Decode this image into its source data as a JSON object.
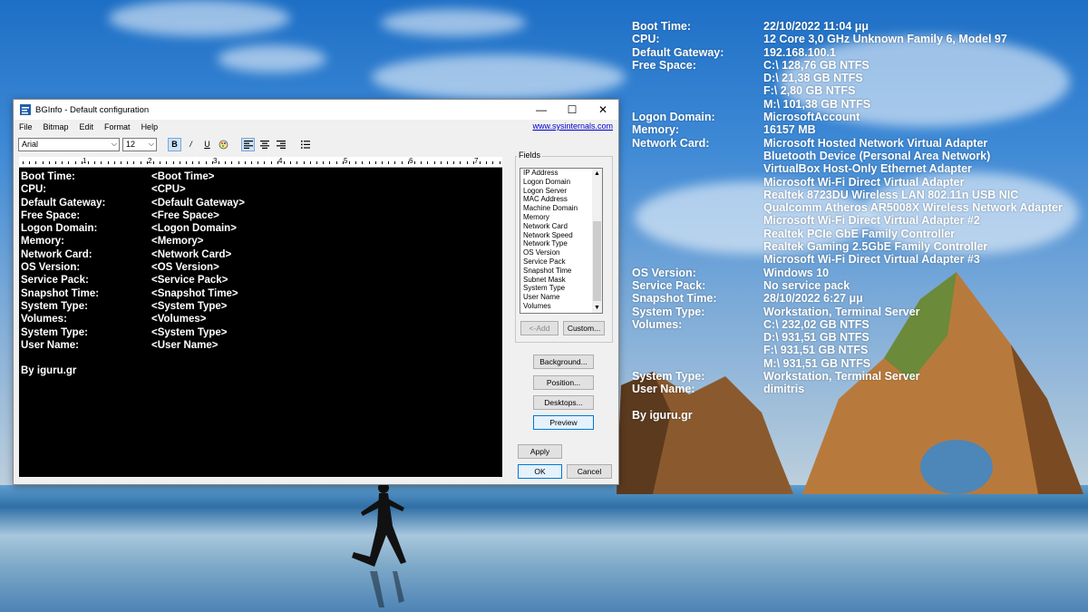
{
  "desktop": {
    "info_rows": [
      {
        "label": "Boot Time:",
        "value": "22/10/2022 11:04 μμ"
      },
      {
        "label": "CPU:",
        "value": "12 Core 3,0 GHz Unknown Family 6, Model 97"
      },
      {
        "label": "Default Gateway:",
        "value": "192.168.100.1"
      },
      {
        "label": "Free Space:",
        "value": "C:\\ 128,76 GB NTFS"
      },
      {
        "label": "",
        "value": "D:\\ 21,38 GB NTFS"
      },
      {
        "label": "",
        "value": "F:\\ 2,80 GB NTFS"
      },
      {
        "label": "",
        "value": "M:\\ 101,38 GB NTFS"
      },
      {
        "label": "Logon Domain:",
        "value": "MicrosoftAccount"
      },
      {
        "label": "Memory:",
        "value": "16157 MB"
      },
      {
        "label": "Network Card:",
        "value": "Microsoft Hosted Network Virtual Adapter"
      },
      {
        "label": "",
        "value": "Bluetooth Device (Personal Area Network)"
      },
      {
        "label": "",
        "value": "VirtualBox Host-Only Ethernet Adapter"
      },
      {
        "label": "",
        "value": "Microsoft Wi-Fi Direct Virtual Adapter"
      },
      {
        "label": "",
        "value": "Realtek 8723DU Wireless LAN 802.11n USB NIC"
      },
      {
        "label": "",
        "value": "Qualcomm Atheros AR5008X Wireless Network Adapter"
      },
      {
        "label": "",
        "value": "Microsoft Wi-Fi Direct Virtual Adapter #2"
      },
      {
        "label": "",
        "value": "Realtek PCIe GbE Family Controller"
      },
      {
        "label": "",
        "value": "Realtek Gaming 2.5GbE Family Controller"
      },
      {
        "label": "",
        "value": "Microsoft Wi-Fi Direct Virtual Adapter #3"
      },
      {
        "label": "OS Version:",
        "value": "Windows 10"
      },
      {
        "label": "Service Pack:",
        "value": "No service pack"
      },
      {
        "label": "Snapshot Time:",
        "value": "28/10/2022 6:27 μμ"
      },
      {
        "label": "System Type:",
        "value": "Workstation, Terminal Server"
      },
      {
        "label": "Volumes:",
        "value": "C:\\ 232,02 GB NTFS"
      },
      {
        "label": "",
        "value": "D:\\ 931,51 GB NTFS"
      },
      {
        "label": "",
        "value": "F:\\ 931,51 GB NTFS"
      },
      {
        "label": "",
        "value": "M:\\ 931,51 GB NTFS"
      },
      {
        "label": "System Type:",
        "value": "Workstation, Terminal Server"
      },
      {
        "label": "User Name:",
        "value": "dimitris"
      }
    ],
    "footer": "By  iguru.gr"
  },
  "window": {
    "title": "BGInfo - Default configuration",
    "minimize": "—",
    "maximize": "☐",
    "close": "✕",
    "menu": [
      "File",
      "Bitmap",
      "Edit",
      "Format",
      "Help"
    ],
    "link": "www.sysinternals.com",
    "font_name": "Arial",
    "font_size": "12",
    "toolbar": {
      "bold": "B",
      "italic": "/",
      "underline": "U"
    },
    "ruler_numbers": [
      "1",
      "2",
      "3",
      "4",
      "5",
      "6",
      "7"
    ],
    "editor_rows": [
      {
        "label": "Boot Time:",
        "value": "<Boot Time>"
      },
      {
        "label": "CPU:",
        "value": "<CPU>"
      },
      {
        "label": "Default Gateway:",
        "value": "<Default Gateway>"
      },
      {
        "label": "Free Space:",
        "value": "<Free Space>"
      },
      {
        "label": "Logon Domain:",
        "value": "<Logon Domain>"
      },
      {
        "label": "Memory:",
        "value": "<Memory>"
      },
      {
        "label": "Network Card:",
        "value": "<Network Card>"
      },
      {
        "label": "OS Version:",
        "value": "<OS Version>"
      },
      {
        "label": "Service Pack:",
        "value": "<Service Pack>"
      },
      {
        "label": "Snapshot Time:",
        "value": "<Snapshot Time>"
      },
      {
        "label": "System Type:",
        "value": "<System Type>"
      },
      {
        "label": "Volumes:",
        "value": "<Volumes>"
      },
      {
        "label": "System Type:",
        "value": "<System Type>"
      },
      {
        "label": "User Name:",
        "value": "<User Name>"
      }
    ],
    "editor_footer": "By  iguru.gr",
    "fields_label": "Fields",
    "fields": [
      "IP Address",
      "Logon Domain",
      "Logon Server",
      "MAC Address",
      "Machine Domain",
      "Memory",
      "Network Card",
      "Network Speed",
      "Network Type",
      "OS Version",
      "Service Pack",
      "Snapshot Time",
      "Subnet Mask",
      "System Type",
      "User Name",
      "Volumes"
    ],
    "buttons": {
      "add": "<-Add",
      "custom": "Custom...",
      "background": "Background...",
      "position": "Position...",
      "desktops": "Desktops...",
      "preview": "Preview",
      "apply": "Apply",
      "ok": "OK",
      "cancel": "Cancel"
    }
  },
  "colors": {
    "link": "#0000cc",
    "editor_bg": "#000000",
    "focus": "#0078d7"
  }
}
